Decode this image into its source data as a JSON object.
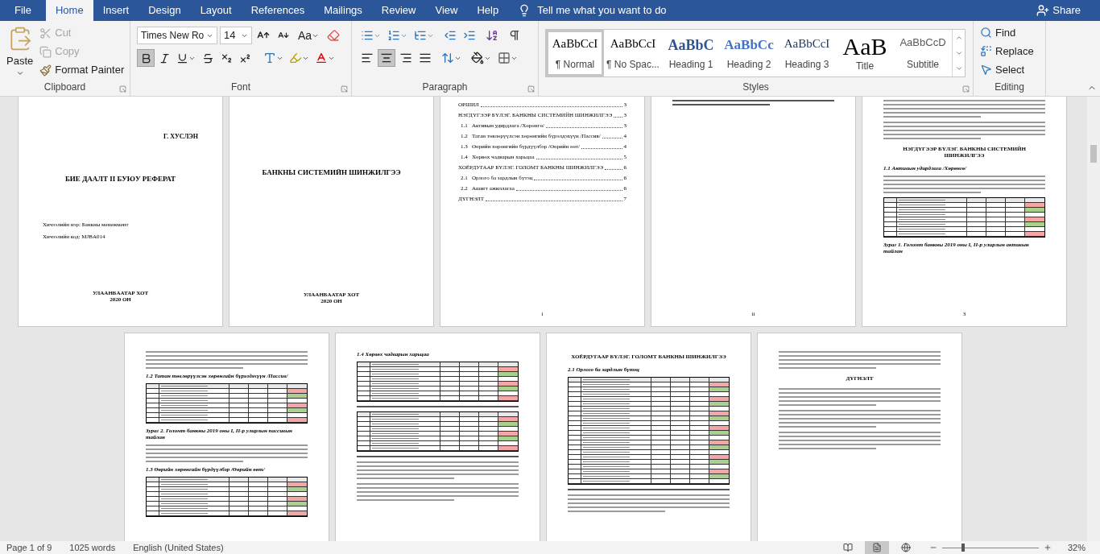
{
  "menu": {
    "tabs": [
      {
        "label": "File",
        "selected": false
      },
      {
        "label": "Home",
        "selected": true
      },
      {
        "label": "Insert",
        "selected": false
      },
      {
        "label": "Design",
        "selected": false
      },
      {
        "label": "Layout",
        "selected": false
      },
      {
        "label": "References",
        "selected": false
      },
      {
        "label": "Mailings",
        "selected": false
      },
      {
        "label": "Review",
        "selected": false
      },
      {
        "label": "View",
        "selected": false
      },
      {
        "label": "Help",
        "selected": false
      }
    ],
    "tell_me": "Tell me what you want to do",
    "share": "Share"
  },
  "ribbon": {
    "clipboard": {
      "label": "Clipboard",
      "paste": "Paste",
      "items": [
        {
          "label": "Cut",
          "kind": "cut",
          "disabled": true
        },
        {
          "label": "Copy",
          "kind": "copy",
          "disabled": true
        },
        {
          "label": "Format Painter",
          "kind": "painter",
          "disabled": false
        }
      ]
    },
    "font": {
      "label": "Font",
      "name": "Times New Ro",
      "size": "14",
      "change_case": "Aa",
      "bold": true,
      "italic": false,
      "underline": false,
      "strikethrough": false,
      "subscript": false,
      "superscript": false
    },
    "paragraph": {
      "label": "Paragraph",
      "alignments": [
        {
          "kind": "left",
          "selected": false
        },
        {
          "kind": "center",
          "selected": true
        },
        {
          "kind": "right",
          "selected": false
        },
        {
          "kind": "justify",
          "selected": false
        }
      ],
      "show_marks": false
    },
    "styles": {
      "label": "Styles",
      "items": [
        {
          "preview": "AaBbCcI",
          "label": "¶ Normal",
          "kind": "normal",
          "selected": true
        },
        {
          "preview": "AaBbCcI",
          "label": "¶ No Spac...",
          "kind": "normal",
          "selected": false
        },
        {
          "preview": "AaBbC",
          "label": "Heading 1",
          "kind": "heading1",
          "selected": false
        },
        {
          "preview": "AaBbCc",
          "label": "Heading 2",
          "kind": "heading2",
          "selected": false
        },
        {
          "preview": "AaBbCcI",
          "label": "Heading 3",
          "kind": "heading3",
          "selected": false
        },
        {
          "preview": "AaB",
          "label": "Title",
          "kind": "title",
          "selected": false
        },
        {
          "preview": "AaBbCcD",
          "label": "Subtitle",
          "kind": "subtitle",
          "selected": false
        }
      ]
    },
    "editing": {
      "label": "Editing",
      "items": [
        {
          "label": "Find",
          "kind": "find"
        },
        {
          "label": "Replace",
          "kind": "replace"
        },
        {
          "label": "Select",
          "kind": "select"
        }
      ]
    }
  },
  "pages_top": [
    {
      "kind": "cover",
      "author": "Г. ХУСЛЭН",
      "title": "БИЕ ДААЛТ II БУЮУ РЕФЕРАТ",
      "meta": [
        "Хичээлийн нэр: Банкны менежмент",
        "Хичээлийн код: МJBA014"
      ],
      "footer": [
        "УЛААНБААТАР ХОТ",
        "2020 ОН"
      ]
    },
    {
      "kind": "title",
      "title": "БАНКНЫ СИСТЕМИЙН ШИНЖИЛГЭЭ",
      "footer": [
        "УЛААНБААТАР ХОТ",
        "2020 ОН"
      ]
    },
    {
      "kind": "toc",
      "page_number": "i",
      "entries": [
        {
          "label": "ОРШИЛ",
          "page": "3"
        },
        {
          "label": "НЭГДҮГЭЭР БҮЛЭГ. БАНКНЫ СИСТЕМИЙН ШИНЖИЛГЭЭ",
          "page": "3",
          "children": [
            {
              "number": "1.1",
              "label": "Активын удирдлага /Хөрөнгө/",
              "page": "3"
            },
            {
              "number": "1.2",
              "label": "Татан төвлөрүүлсэн хөрөнгийн бүрэлдэхүүн /Пассив/",
              "page": "4"
            },
            {
              "number": "1.3",
              "label": "Өөрийн хөрөнгийн бүрдүүлбэр /Өөрийн өөт/",
              "page": "4"
            },
            {
              "number": "1.4",
              "label": "Хөрвөх чадварын харьцаа",
              "page": "5"
            }
          ]
        },
        {
          "label": "ХОЁРДУГААР БҮЛЭГ. ГОЛОМТ БАНКНЫ ШИНЖИЛГЭЭ",
          "page": "6",
          "children": [
            {
              "number": "2.1",
              "label": "Орлого ба зардлын бүтэц",
              "page": "6"
            },
            {
              "number": "2.2",
              "label": "Ашигт ажиллагаа",
              "page": "6"
            }
          ]
        },
        {
          "label": "ДҮГНЭЛТ",
          "page": "7"
        }
      ]
    },
    {
      "kind": "body",
      "page_number": "ii",
      "blocks": [
        {
          "kind": "italic_lines"
        }
      ]
    },
    {
      "kind": "body",
      "page_number": "3",
      "blocks": [
        {
          "kind": "text"
        },
        {
          "kind": "text"
        },
        {
          "kind": "chapter",
          "text": "НЭГДҮГЭЭР БҮЛЭГ. БАНКНЫ СИСТЕМИЙН ШИНЖИЛГЭЭ"
        },
        {
          "kind": "heading",
          "text": "1.1 Активын удирдлага /Хөрөнгө/"
        },
        {
          "kind": "text"
        },
        {
          "kind": "table"
        },
        {
          "kind": "caption",
          "text": "Зураг 1. Голомт банкны 2019 оны I, II-р улирлын активын тайлан"
        }
      ]
    }
  ],
  "pages_bottom": [
    {
      "kind": "body",
      "blocks": [
        {
          "kind": "text"
        },
        {
          "kind": "heading",
          "text": "1.2 Татан төвлөрүүлсэн хөрөнгийн бүрэлдэхүүн /Пассив/"
        },
        {
          "kind": "table"
        },
        {
          "kind": "caption",
          "text": "Зураг 2. Голомт банкны 2019 оны I, II-р улирлын пассивын тайлан"
        },
        {
          "kind": "text"
        },
        {
          "kind": "heading",
          "text": "1.3 Өөрийн хөрөнгийн бүрдүүлбэр /Өөрийн өөт/"
        },
        {
          "kind": "table"
        }
      ]
    },
    {
      "kind": "body",
      "blocks": [
        {
          "kind": "heading",
          "text": "1.4 Хөрвөх чадварын харьцаа"
        },
        {
          "kind": "table"
        },
        {
          "kind": "caption_lines"
        },
        {
          "kind": "table"
        },
        {
          "kind": "caption_lines"
        },
        {
          "kind": "text"
        },
        {
          "kind": "text"
        }
      ]
    },
    {
      "kind": "body",
      "blocks": [
        {
          "kind": "chapter",
          "text": "ХОЁРДУГААР БҮЛЭГ. ГОЛОМТ БАНКНЫ ШИНЖИЛГЭЭ"
        },
        {
          "kind": "heading",
          "text": "2.1 Орлого ба зардлын бүтэц"
        },
        {
          "kind": "table_tall"
        },
        {
          "kind": "caption_lines"
        },
        {
          "kind": "text"
        }
      ]
    },
    {
      "kind": "body",
      "blocks": [
        {
          "kind": "text"
        },
        {
          "kind": "chapter",
          "text": "ДҮГНЭЛТ"
        },
        {
          "kind": "text"
        },
        {
          "kind": "text"
        },
        {
          "kind": "text"
        }
      ]
    }
  ],
  "status_bar": {
    "page": "Page 1 of 9",
    "words": "1025 words",
    "language": "English (United States)",
    "views": [
      {
        "kind": "read",
        "selected": false
      },
      {
        "kind": "print",
        "selected": true
      },
      {
        "kind": "web",
        "selected": false
      }
    ],
    "zoom": {
      "level": 0.22,
      "reading": "32%"
    }
  }
}
